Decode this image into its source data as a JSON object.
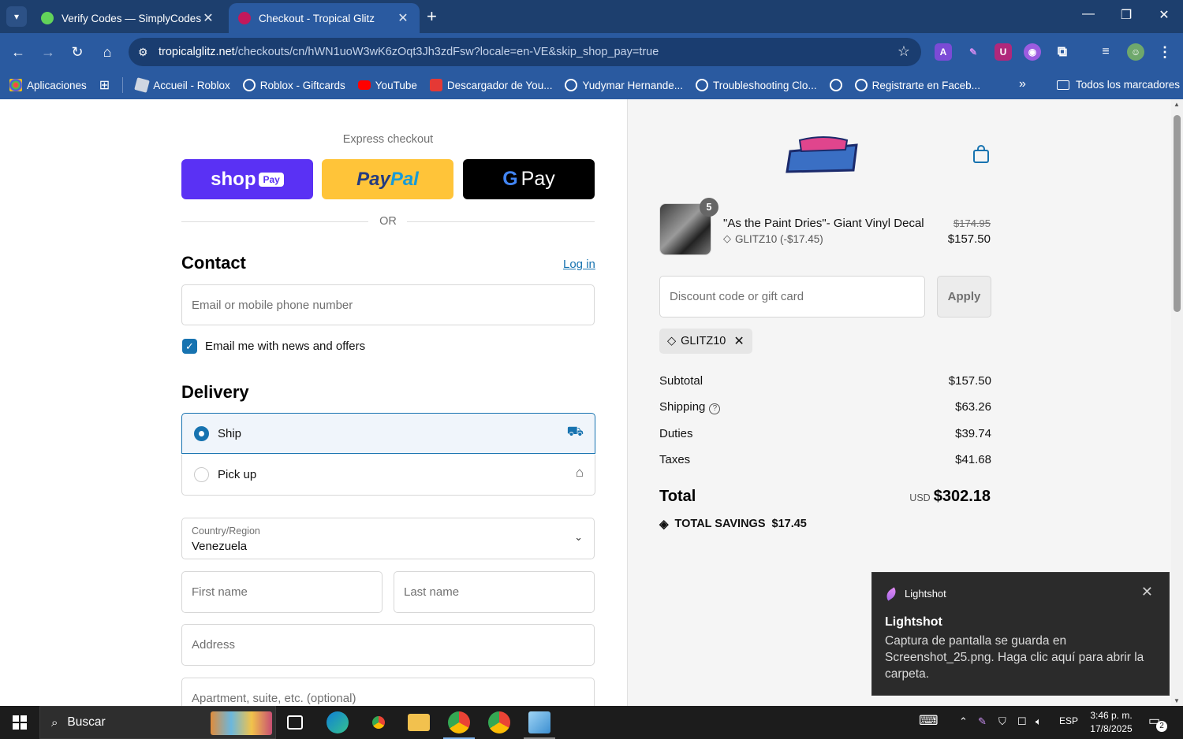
{
  "browser": {
    "tabs": [
      {
        "title": "Verify Codes — SimplyCodes",
        "favicon": "simplycodes-icon",
        "active": false
      },
      {
        "title": "Checkout - Tropical Glitz",
        "favicon": "tropical-glitz-icon",
        "active": true
      }
    ],
    "url_host": "tropicalglitz.net",
    "url_path": "/checkouts/cn/hWN1uoW3wK6zOqt3Jh3zdFsw?locale=en-VE&skip_shop_pay=true",
    "bookmarks": [
      {
        "label": "Aplicaciones",
        "icon": "apps-grid-icon"
      },
      {
        "label": "",
        "icon": "grid-icon"
      },
      {
        "label": "Accueil - Roblox",
        "icon": "roblox-icon"
      },
      {
        "label": "Roblox - Giftcards",
        "icon": "globe-icon"
      },
      {
        "label": "YouTube",
        "icon": "youtube-icon"
      },
      {
        "label": "Descargador de You...",
        "icon": "download-icon"
      },
      {
        "label": "Yudymar Hernande...",
        "icon": "globe-icon"
      },
      {
        "label": "Troubleshooting Clo...",
        "icon": "globe-icon"
      },
      {
        "label": "",
        "icon": "globe-icon"
      },
      {
        "label": "Registrarte en Faceb...",
        "icon": "globe-icon"
      }
    ],
    "all_bookmarks": "Todos los marcadores"
  },
  "checkout": {
    "express_label": "Express checkout",
    "shoppay_label": "shop",
    "shoppay_badge": "Pay",
    "paypal_pay": "Pay",
    "paypal_pal": "Pal",
    "gpay_g": "G",
    "gpay_label": "Pay",
    "or_label": "OR",
    "contact_heading": "Contact",
    "login_label": "Log in",
    "email_placeholder": "Email or mobile phone number",
    "news_label": "Email me with news and offers",
    "news_checked": true,
    "delivery_heading": "Delivery",
    "ship_label": "Ship",
    "pickup_label": "Pick up",
    "country_label": "Country/Region",
    "country_value": "Venezuela",
    "first_name_placeholder": "First name",
    "last_name_placeholder": "Last name",
    "address_placeholder": "Address",
    "apartment_placeholder": "Apartment, suite, etc. (optional)"
  },
  "summary": {
    "quantity": "5",
    "product_name": "\"As the Paint Dries\"- Giant Vinyl Decal",
    "product_discount": "GLITZ10 (-$17.45)",
    "price_original": "$174.95",
    "price_final": "$157.50",
    "discount_placeholder": "Discount code or gift card",
    "apply_label": "Apply",
    "applied_code": "GLITZ10",
    "rows": [
      {
        "label": "Subtotal",
        "value": "$157.50"
      },
      {
        "label": "Shipping",
        "value": "$63.26"
      },
      {
        "label": "Duties",
        "value": "$39.74"
      },
      {
        "label": "Taxes",
        "value": "$41.68"
      }
    ],
    "total_label": "Total",
    "currency": "USD",
    "total_value": "$302.18",
    "savings_label": "TOTAL SAVINGS",
    "savings_value": "$17.45"
  },
  "toast": {
    "app": "Lightshot",
    "title": "Lightshot",
    "message": "Captura de pantalla se guarda en Screenshot_25.png. Haga clic aquí para abrir la carpeta."
  },
  "taskbar": {
    "search_label": "Buscar",
    "lang": "ESP",
    "time": "3:46 p. m.",
    "date": "17/8/2025",
    "notifications": "2"
  },
  "colors": {
    "accent": "#1773b0",
    "shoppay": "#5a31f4",
    "paypal": "#ffc439",
    "chrome": "#2a5aa0"
  }
}
